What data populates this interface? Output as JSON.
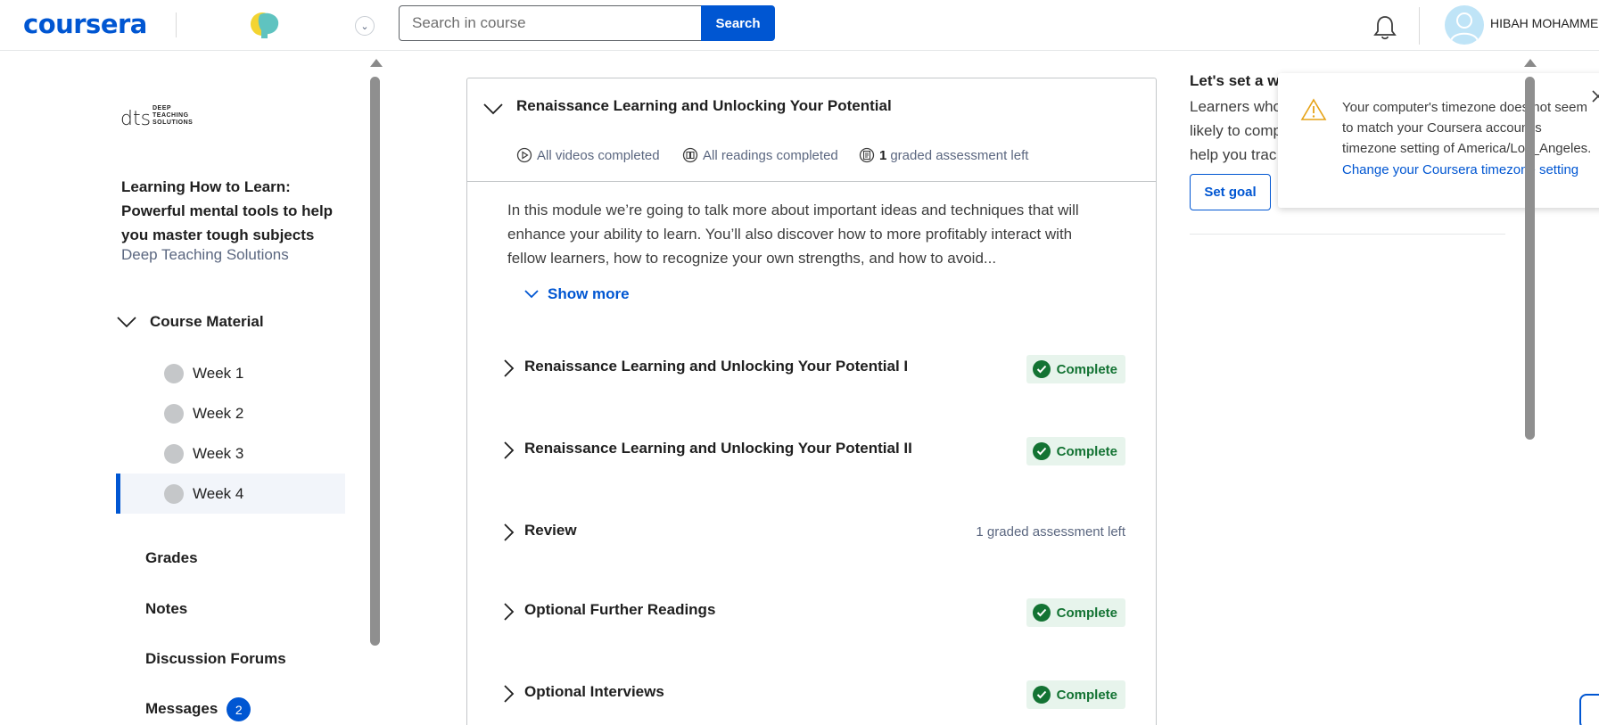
{
  "header": {
    "logo_text": "coursera",
    "search_placeholder": "Search in course",
    "search_button": "Search",
    "username": "HIBAH MOHAMME..."
  },
  "sidebar": {
    "partner_logo_text": "DEEP TEACHING SOLUTIONS",
    "course_title": "Learning How to Learn: Powerful mental tools to help you master tough subjects",
    "course_org": "Deep Teaching Solutions",
    "course_material_label": "Course Material",
    "weeks": [
      {
        "label": "Week 1",
        "active": false
      },
      {
        "label": "Week 2",
        "active": false
      },
      {
        "label": "Week 3",
        "active": false
      },
      {
        "label": "Week 4",
        "active": true
      }
    ],
    "links": {
      "grades": "Grades",
      "notes": "Notes",
      "forums": "Discussion Forums",
      "messages": "Messages",
      "messages_count": "2"
    }
  },
  "module": {
    "title": "Renaissance Learning and Unlocking Your Potential",
    "stats": {
      "videos": "All videos completed",
      "readings": "All readings completed",
      "graded_count": "1",
      "graded_text": "graded assessment left"
    },
    "description": "In this module we’re going to talk more about important ideas and techniques that will enhance your ability to learn. You’ll also discover how to more profitably interact with fellow learners, how to recognize your own strengths, and how to avoid...",
    "show_more": "Show more",
    "lessons": [
      {
        "title": "Renaissance Learning and Unlocking Your Potential I",
        "status": "Complete"
      },
      {
        "title": "Renaissance Learning and Unlocking Your Potential II",
        "status": "Complete"
      },
      {
        "title": "Review",
        "status": "1 graded assessment left"
      },
      {
        "title": "Optional Further Readings",
        "status": "Complete"
      },
      {
        "title": "Optional Interviews",
        "status": "Complete"
      }
    ]
  },
  "goal_panel": {
    "title": "Let's set a we",
    "lines": [
      "Learners who",
      "likely to comp",
      "help you trac"
    ],
    "button": "Set goal"
  },
  "toast": {
    "message": "Your computer's timezone does not seem to match your Coursera account's timezone setting of America/Los_Angeles.",
    "link": "Change your Coursera timezone setting"
  },
  "colors": {
    "brand": "#0056d2",
    "complete_green": "#137333",
    "complete_bg": "#e7f4ec",
    "warning": "#e6a317"
  }
}
